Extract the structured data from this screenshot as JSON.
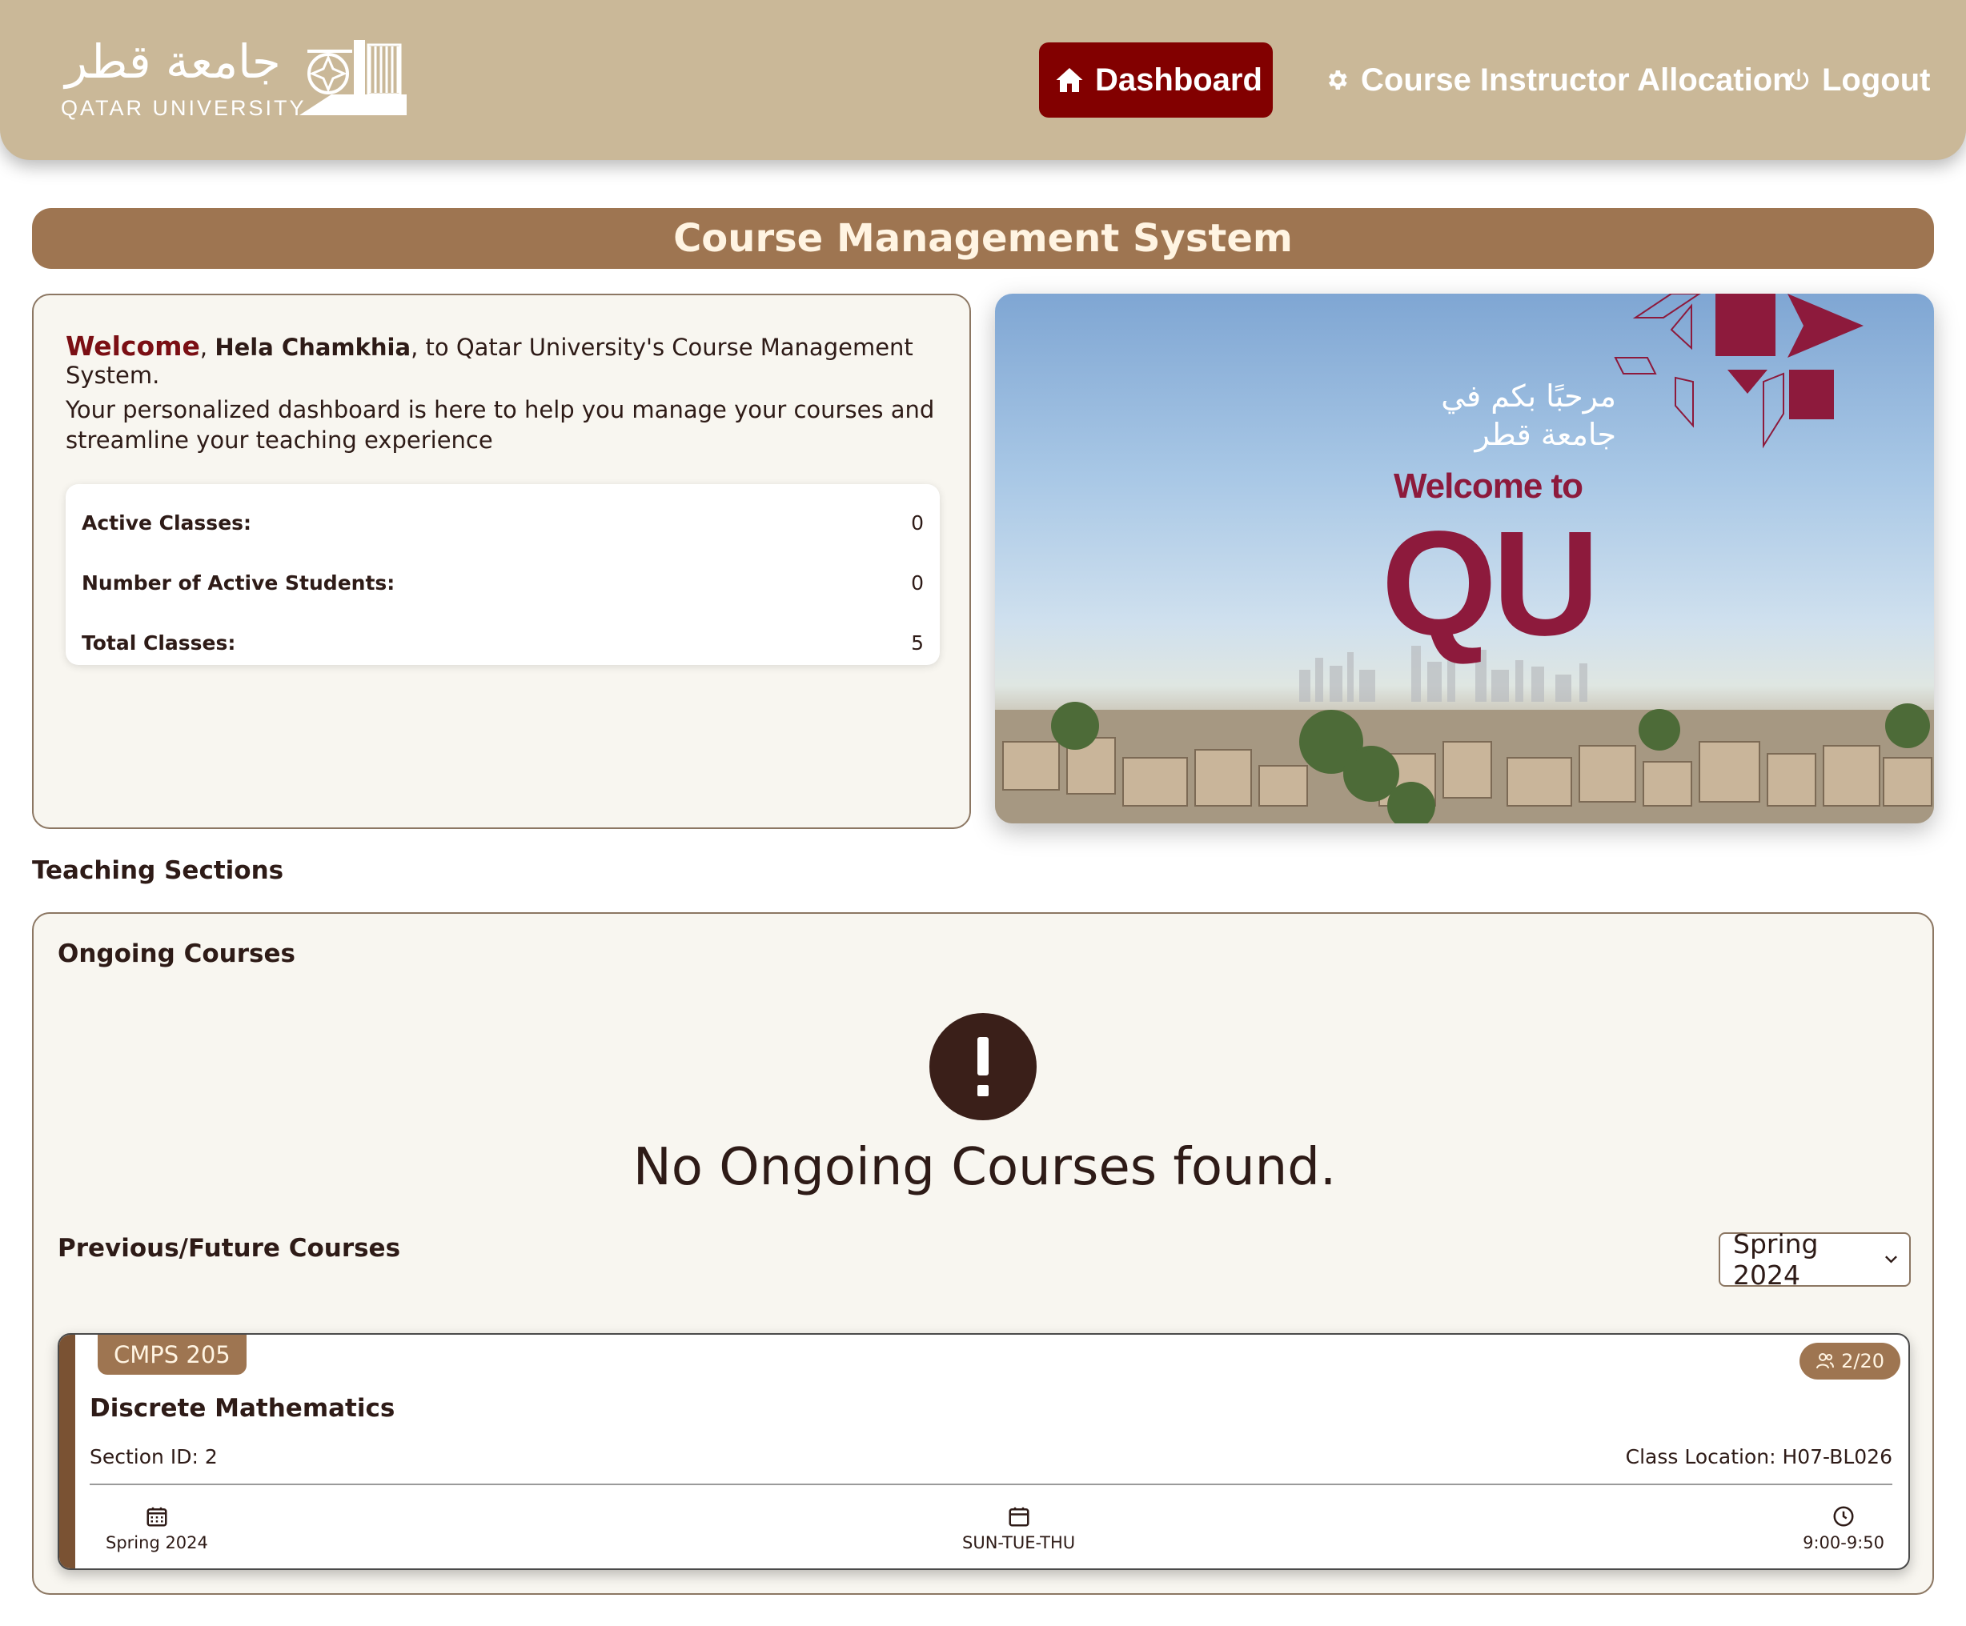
{
  "header": {
    "logo": {
      "arabic": "جامعة قطر",
      "english": "QATAR UNIVERSITY"
    },
    "nav": [
      {
        "label": "Dashboard",
        "icon": "home-icon",
        "active": true
      },
      {
        "label": "Course Instructor Allocation",
        "icon": "gear-icon",
        "active": false
      },
      {
        "label": "Logout",
        "icon": "power-icon",
        "active": false
      }
    ]
  },
  "page_title": "Course Management System",
  "welcome": {
    "greeting": "Welcome",
    "separator": ", ",
    "name": "Hela Chamkhia",
    "suffix": ", to Qatar University's Course Management System.",
    "description": "Your personalized dashboard is here to help you manage your courses and streamline your teaching experience",
    "stats": [
      {
        "label": "Active Classes:",
        "value": "0"
      },
      {
        "label": "Number of Active Students:",
        "value": "0"
      },
      {
        "label": "Total Classes:",
        "value": "5"
      }
    ]
  },
  "hero": {
    "arabic_line1": "مرحبًا بكم في",
    "arabic_line2": "جامعة قطر",
    "welcome_text": "Welcome to",
    "brand": "QU"
  },
  "teaching": {
    "heading": "Teaching Sections",
    "ongoing_title": "Ongoing Courses",
    "empty_message": "No Ongoing Courses found.",
    "previous_title": "Previous/Future Courses",
    "term_selected": "Spring 2024",
    "courses": [
      {
        "code": "CMPS 205",
        "enrollment": "2/20",
        "name": "Discrete Mathematics",
        "section": "Section ID: 2",
        "location": "Class Location: H07-BL026",
        "term": "Spring 2024",
        "days": "SUN-TUE-THU",
        "time": "9:00-9:50"
      }
    ]
  },
  "colors": {
    "header_bg": "#cab898",
    "accent_red": "#820000",
    "title_bar": "#9e7551",
    "brand_maroon": "#8d1a3c",
    "panel_bg": "#f8f6f0"
  }
}
